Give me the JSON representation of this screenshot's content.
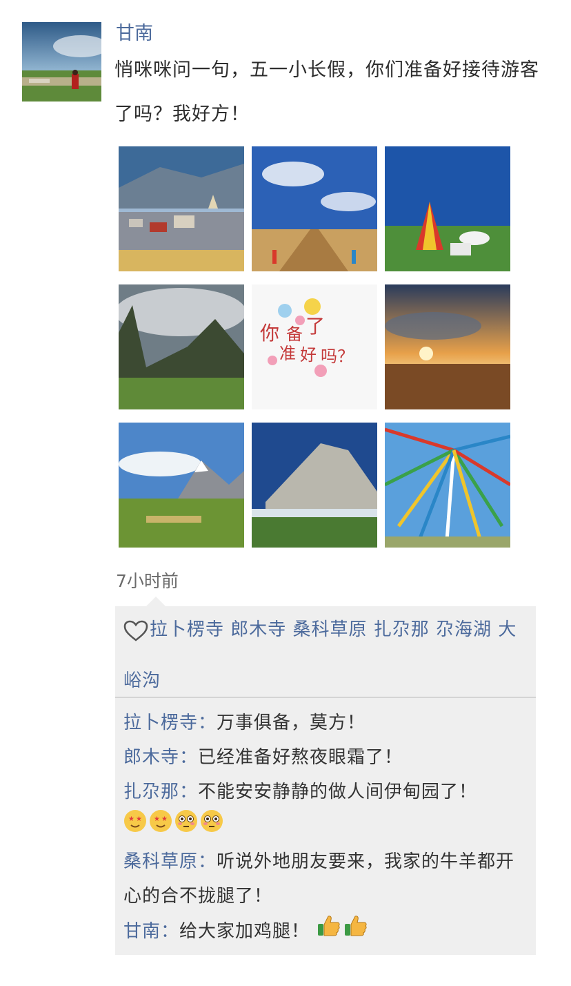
{
  "post": {
    "author": "甘南",
    "text": "悄咪咪问一句，五一小长假，你们准备好接待游客了吗？我好方！",
    "time": "7小时前",
    "images": [
      {
        "name": "temple-town-photo"
      },
      {
        "name": "boardwalk-sky-photo"
      },
      {
        "name": "prayer-tent-grassland-photo"
      },
      {
        "name": "cloudy-valley-photo"
      },
      {
        "name": "are-you-ready-sticker",
        "sticker_text": "你备好了准吗？"
      },
      {
        "name": "sunset-grassland-photo"
      },
      {
        "name": "snow-mountain-village-photo"
      },
      {
        "name": "rock-peak-photo"
      },
      {
        "name": "prayer-flags-photo"
      }
    ]
  },
  "likes": {
    "icon": "heart-outline-icon",
    "names": "拉卜楞寺 郎木寺 桑科草原 扎尕那 尕海湖 大峪沟"
  },
  "comments": [
    {
      "author": "拉卜楞寺",
      "sep": "：",
      "text": "万事俱备，莫方！"
    },
    {
      "author": "郎木寺",
      "sep": "：",
      "text": "已经准备好熬夜眼霜了！"
    },
    {
      "author": "扎尕那",
      "sep": "：",
      "text": "不能安安静静的做人间伊甸园了！",
      "emojis": [
        "star-struck-emoji",
        "star-struck-emoji",
        "flushed-emoji",
        "flushed-emoji"
      ]
    },
    {
      "author": "桑科草原",
      "sep": "：",
      "text": "听说外地朋友要来，我家的牛羊都开心的合不拢腿了！"
    },
    {
      "author": "甘南",
      "sep": "：",
      "text": "给大家加鸡腿！",
      "emojis": [
        "thumbs-up-emoji",
        "thumbs-up-emoji"
      ]
    }
  ],
  "colors": {
    "link": "#4c6a9c",
    "panel": "#efefef",
    "text": "#2d2d2d"
  }
}
